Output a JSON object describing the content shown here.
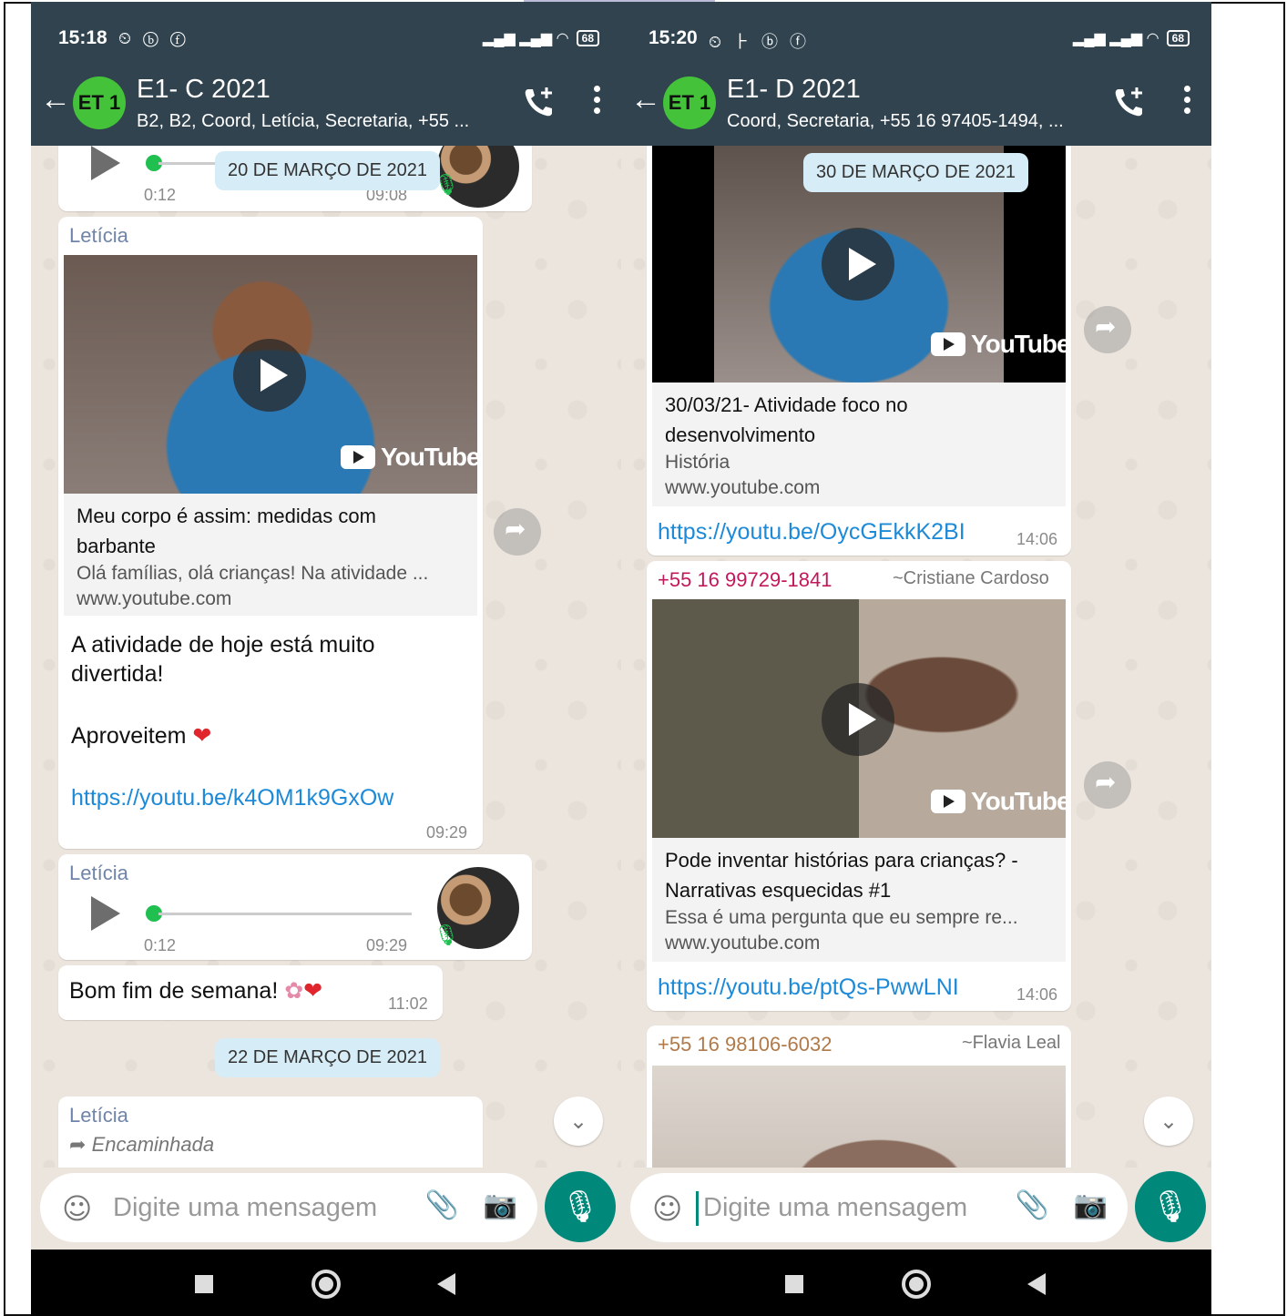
{
  "left": {
    "status": {
      "time": "15:18",
      "icons": "⏲ ⓑ ⓕ",
      "battery": "68"
    },
    "header": {
      "back": "←",
      "avatar_text": "ET 1",
      "title": "E1- C 2021",
      "subtitle": "B2, B2, Coord, Letícia, Secretaria, +55 ..."
    },
    "msg1": {
      "date": "20 DE MARÇO DE 2021",
      "duration": "0:12",
      "time": "09:08"
    },
    "msg2": {
      "sender": "Letícia",
      "yt": "YouTube",
      "link_title": "Meu corpo é assim: medidas com barbante",
      "link_desc": "Olá famílias, olá crianças! Na atividade ...",
      "link_domain": "www.youtube.com",
      "text1": "A atividade de hoje está muito divertida!",
      "text2": "Aproveitem",
      "url": "https://youtu.be/k4OM1k9GxOw",
      "time": "09:29"
    },
    "msg3": {
      "sender": "Letícia",
      "duration": "0:12",
      "time": "09:29"
    },
    "msg4": {
      "text": "Bom fim de semana!",
      "time": "11:02"
    },
    "date2": "22 DE MARÇO DE 2021",
    "msg5": {
      "sender": "Letícia",
      "forwarded": "Encaminhada"
    },
    "input": {
      "placeholder": "Digite uma mensagem"
    }
  },
  "right": {
    "status": {
      "time": "15:20",
      "icons": "⏲ ⺊ ⓑ ⓕ",
      "battery": "68"
    },
    "header": {
      "back": "←",
      "avatar_text": "ET 1",
      "title": "E1- D 2021",
      "subtitle": "Coord, Secretaria, +55 16 97405-1494, ..."
    },
    "msg1": {
      "date": "30 DE MARÇO DE 2021",
      "yt": "YouTube",
      "link_title": "30/03/21- Atividade foco no desenvolvimento",
      "link_desc": "História",
      "link_domain": "www.youtube.com",
      "url": "https://youtu.be/OycGEkkK2BI",
      "time": "14:06"
    },
    "msg2": {
      "phone": "+55 16 99729-1841",
      "name": "~Cristiane Cardoso",
      "yt": "YouTube",
      "link_title": "Pode inventar histórias para crianças? - Narrativas esquecidas #1",
      "link_desc": "Essa é uma pergunta que eu sempre re...",
      "link_domain": "www.youtube.com",
      "url": "https://youtu.be/ptQs-PwwLNI",
      "time": "14:06"
    },
    "msg3": {
      "phone": "+55 16 98106-6032",
      "name": "~Flavia Leal"
    },
    "input": {
      "placeholder": "Digite uma mensagem"
    }
  },
  "colors": {
    "header": "#30434f",
    "chat_bg": "#ece5dd",
    "accent": "#00897b",
    "link": "#1d8ad8",
    "sender": "#6f84a8",
    "phone1": "#c2185b",
    "phone2": "#b07a4a"
  }
}
